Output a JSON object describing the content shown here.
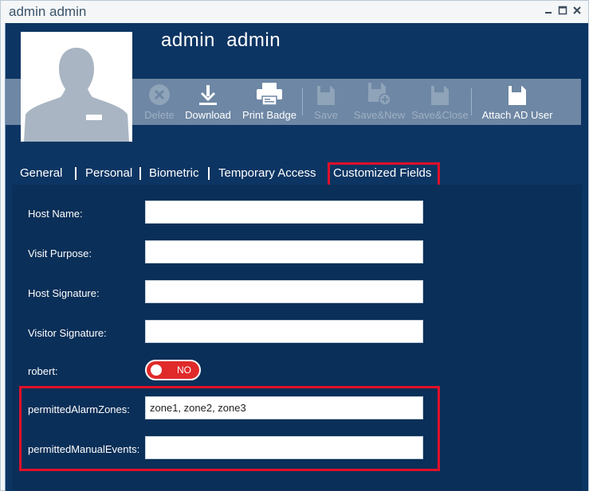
{
  "window": {
    "title": "admin admin",
    "controls": [
      "close-icon",
      "maximize-icon",
      "close-x-icon"
    ]
  },
  "user": {
    "display_name": "admin  admin"
  },
  "toolbar": {
    "delete_label": "Delete",
    "download_label": "Download",
    "print_badge_label": "Print Badge",
    "save_label": "Save",
    "save_new_label": "Save&New",
    "save_close_label": "Save&Close",
    "attach_ad_label": "Attach AD User"
  },
  "tabs": [
    {
      "label": "General"
    },
    {
      "label": "Personal"
    },
    {
      "label": "Biometric"
    },
    {
      "label": "Temporary Access"
    },
    {
      "label": "Customized Fields",
      "active": true
    }
  ],
  "fields": [
    {
      "label": "Host Name:",
      "value": ""
    },
    {
      "label": "Visit Purpose:",
      "value": ""
    },
    {
      "label": "Host Signature:",
      "value": ""
    },
    {
      "label": "Visitor Signature:",
      "value": ""
    },
    {
      "label": "robert:",
      "toggle_state": "NO"
    },
    {
      "label": "permittedAlarmZones:",
      "value": "zone1, zone2, zone3"
    },
    {
      "label": "permittedManualEvents:",
      "value": ""
    }
  ],
  "colors": {
    "background": "#0d3563",
    "toolbar": "#6e87a4",
    "highlight": "#e0102a",
    "toggle_off": "#e02a2a"
  }
}
